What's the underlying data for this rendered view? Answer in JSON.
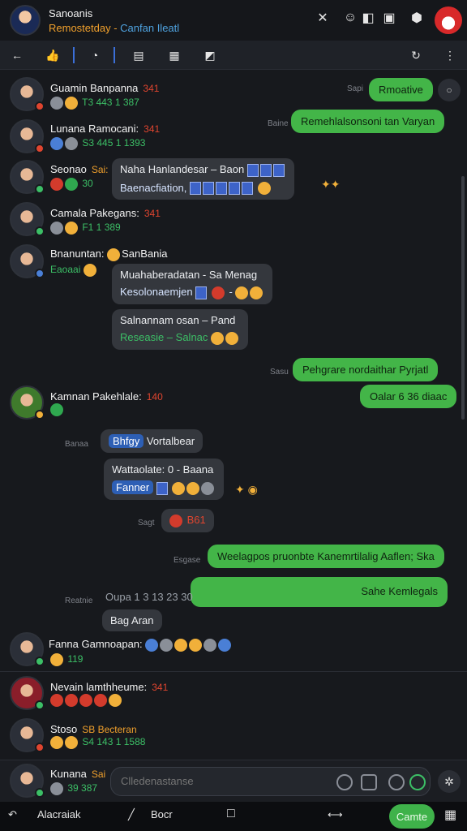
{
  "titlebar": {
    "title": "Sanoanis",
    "subtitle": "Remostetday",
    "subtitle_link": "Canfan Ileatl"
  },
  "icons": {
    "back": "arrow-left-icon",
    "close": "close-icon",
    "more": "vertical-dots-icon"
  },
  "members": [
    {
      "name": "Guamin Banpanna",
      "tag": "341",
      "meta": "T3 443 1 387",
      "status_color": "#3cbf66"
    },
    {
      "name": "Lunana Ramocani:",
      "tag": "341",
      "meta": "S3 445 1 1393",
      "status_color": "#e0452f"
    },
    {
      "name": "Seonao",
      "tag": "Sai:",
      "meta": "30",
      "status_color": "#3cbf66"
    },
    {
      "name": "Camala Pakegans:",
      "tag": "341",
      "meta": "F1 1 389",
      "status_color": "#3cbf66"
    },
    {
      "name": "Bnanuntan:",
      "tag": "SanBania",
      "meta": "Eaoaai",
      "status_color": "#4a7fd6"
    },
    {
      "name": "Kamnan Pakehlale:",
      "tag": "140",
      "meta": "",
      "status_color": "#f1b03a"
    },
    {
      "name": "Fanna Gamnoapan:",
      "tag": "",
      "meta": "119",
      "status_color": "#3cbf66"
    },
    {
      "name": "Nevain lamthheume:",
      "tag": "341",
      "meta": "",
      "status_color": "#3cbf66"
    },
    {
      "name": "Stoso",
      "tag": "SB Becteran",
      "meta": "S4 143 1 1588",
      "status_color": "#e0452f"
    },
    {
      "name": "Kunana",
      "tag": "Sai",
      "meta": "39 387",
      "status_color": "#3cbf66"
    }
  ],
  "messages": {
    "out1": {
      "text": "Rmoative",
      "time": "Sapi"
    },
    "out2": {
      "text": "Remehlalsonsoni tan Varyan",
      "time": "Baine"
    },
    "in1": {
      "line1": "Naha Hanlandesar – Baon",
      "line2": "Baenacfiation,"
    },
    "in2": {
      "line1": "Muahaberadatan - Sa Menag",
      "line2": "Kesolonaemjen"
    },
    "in3": {
      "line1": "Salnannam osan – Pand",
      "line2": "Reseasie – Salnac"
    },
    "out3": {
      "text": "Pehgrare nordaithar Pyrjatl",
      "time": "Sasu"
    },
    "out4": {
      "text": "Oalar 6 36 diaac",
      "time": ""
    },
    "in4": {
      "chip": "Bhfgy",
      "text": "Vortalbear",
      "time": "Banaa"
    },
    "in5": {
      "line1": "Wattaolate: 0 - Baana",
      "line2": "Fanner"
    },
    "in6": {
      "text": "B61",
      "time": "Sagt"
    },
    "out5": {
      "text": "Weelagpos pruonbte Kanemrtilalig Aaflen; Ska",
      "time": "Esgase"
    },
    "out6": {
      "text": "Sahe Kemlegals",
      "time": ""
    },
    "in7": {
      "head": "Oupa 1 3 13 23 30",
      "text": "Bag Aran",
      "time": "Reatnie"
    }
  },
  "composer": {
    "placeholder": "Clledenastanse"
  },
  "bottombar": {
    "left_label": "Alacraiak",
    "mid_label": "Bocr",
    "send_label": "Camte"
  }
}
